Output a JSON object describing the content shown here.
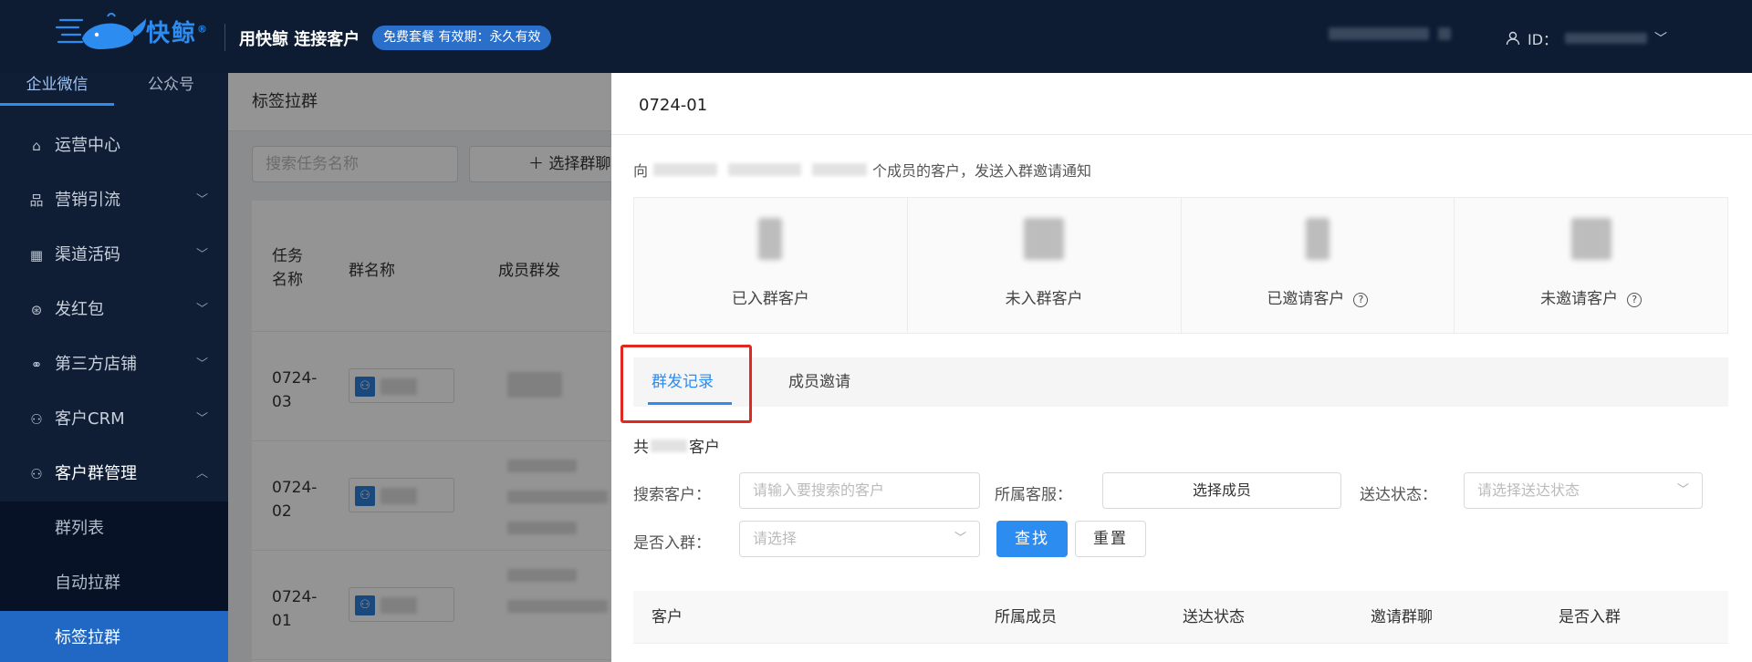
{
  "brand": {
    "name": "快鲸",
    "registered": "®",
    "slogan": "用快鲸 连接客户",
    "plan": "免费套餐 有效期：永久有效"
  },
  "user": {
    "id_label": "ID："
  },
  "sidebar": {
    "tabs": [
      "企业微信",
      "公众号"
    ],
    "items": [
      {
        "label": "运营中心",
        "icon": "home-icon"
      },
      {
        "label": "营销引流",
        "icon": "sitemap-icon"
      },
      {
        "label": "渠道活码",
        "icon": "qrcode-icon"
      },
      {
        "label": "发红包",
        "icon": "yuan-icon"
      },
      {
        "label": "第三方店铺",
        "icon": "link-icon"
      },
      {
        "label": "客户CRM",
        "icon": "users-icon"
      },
      {
        "label": "客户群管理",
        "icon": "group-icon"
      }
    ],
    "subitems": [
      "群列表",
      "自动拉群",
      "标签拉群"
    ]
  },
  "page": {
    "title": "标签拉群",
    "search_placeholder": "搜索任务名称",
    "select_group_button": "＋ 选择群聊",
    "table_headers": [
      "任务名称",
      "群名称",
      "成员群发"
    ],
    "rows": [
      {
        "name": "0724-03"
      },
      {
        "name": "0724-02"
      },
      {
        "name": "0724-01"
      }
    ]
  },
  "drawer": {
    "title": "0724-01",
    "notice_prefix": "向",
    "notice_suffix": "个成员的客户，发送入群邀请通知",
    "stats": [
      {
        "label": "已入群客户",
        "help": false
      },
      {
        "label": "未入群客户",
        "help": false
      },
      {
        "label": "已邀请客户",
        "help": true
      },
      {
        "label": "未邀请客户",
        "help": true
      }
    ],
    "tabs": {
      "active": "群发记录",
      "other": "成员邀请"
    },
    "total_prefix": "共",
    "total_suffix": "客户",
    "filters": {
      "customer_label": "搜索客户：",
      "customer_placeholder": "请输入要搜索的客户",
      "owner_label": "所属客服：",
      "owner_button": "选择成员",
      "status_label": "送达状态：",
      "status_placeholder": "请选择送达状态",
      "joined_label": "是否入群：",
      "joined_placeholder": "请选择",
      "search_button": "查找",
      "reset_button": "重置"
    },
    "result_columns": [
      "客户",
      "所属成员",
      "送达状态",
      "邀请群聊",
      "是否入群"
    ]
  },
  "colors": {
    "primary": "#2d8cf0",
    "sidebar_bg": "#0f1d35",
    "highlight": "#e0281e"
  }
}
